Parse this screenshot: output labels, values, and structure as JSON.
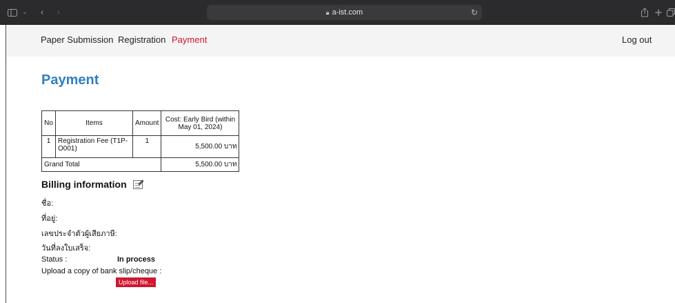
{
  "browser": {
    "url": "a-ist.com",
    "icons": {
      "sidebar": "sidebar-icon",
      "back": "back-icon",
      "forward": "forward-icon",
      "lock": "lock-icon",
      "reload": "reload-icon",
      "share": "share-icon",
      "new_tab": "plus-icon",
      "tabs": "tabs-icon"
    }
  },
  "nav": {
    "items": [
      "Paper Submission",
      "Registration",
      "Payment"
    ],
    "active": "Payment",
    "logout": "Log out"
  },
  "page": {
    "title": "Payment"
  },
  "table": {
    "headers": [
      "No",
      "Items",
      "Amount",
      "Cost: Early Bird (within May 01, 2024)"
    ],
    "rows": [
      {
        "no": "1",
        "item": "Registration Fee (T1P-O001)",
        "amount": "1",
        "cost": "5,500.00 บาท"
      }
    ],
    "grand_total_label": "Grand Total",
    "grand_total_value": "5,500.00 บาท"
  },
  "billing": {
    "title": "Billing information",
    "name_label": "ชื่อ:",
    "address_label": "ที่อยู่:",
    "tax_id_label": "เลขประจำตัวผู้เสียภาษี:",
    "receipt_date_label": "วันที่ลงใบเสร็จ:",
    "status_label": "Status :",
    "status_value": "In process",
    "upload_label": "Upload a copy of bank slip/cheque :",
    "upload_button": "Upload file..."
  },
  "colors": {
    "brand_red": "#d0162f",
    "title_blue": "#2f7fbf",
    "nav_bg": "#f4f4f4"
  }
}
